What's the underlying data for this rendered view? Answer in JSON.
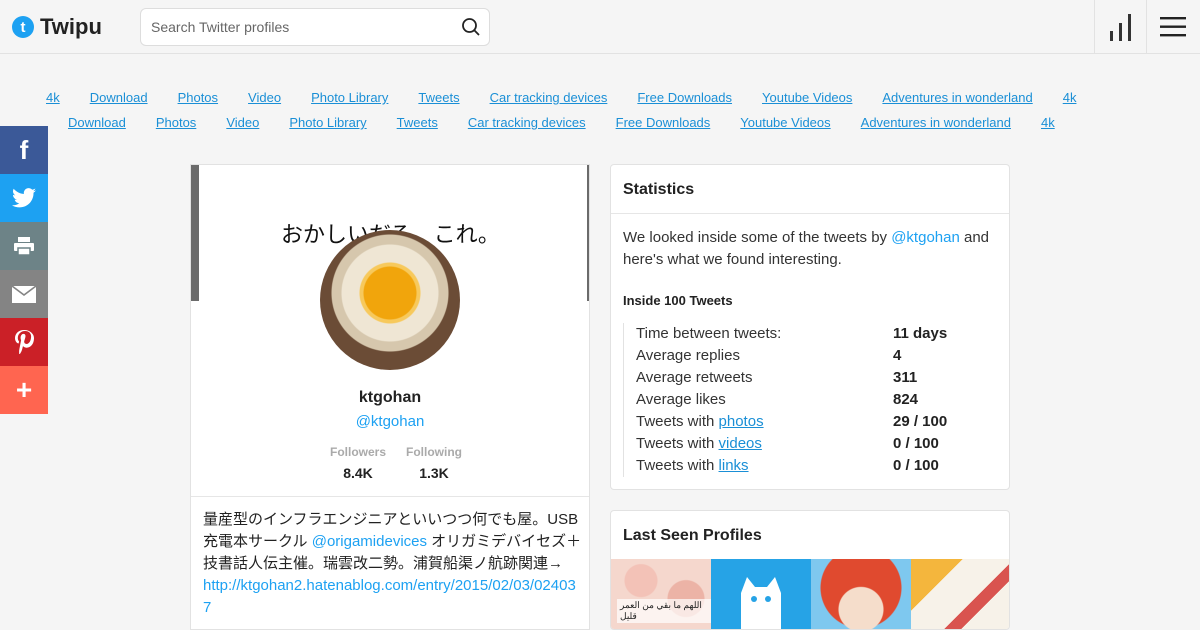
{
  "header": {
    "logo_glyph": "t",
    "logo_text": "Twipu",
    "search_placeholder": "Search Twitter profiles",
    "icons": {
      "search": "search-icon",
      "stats": "bar-chart-icon",
      "menu": "hamburger-menu-icon"
    }
  },
  "links_row1": [
    "4k",
    "Download",
    "Photos",
    "Video",
    "Photo Library",
    "Tweets",
    "Car tracking devices",
    "Free Downloads",
    "Youtube Videos",
    "Adventures in wonderland",
    "4k"
  ],
  "links_row2": [
    "Download",
    "Photos",
    "Video",
    "Photo Library",
    "Tweets",
    "Car tracking devices",
    "Free Downloads",
    "Youtube Videos",
    "Adventures in wonderland",
    "4k"
  ],
  "social": {
    "facebook": "f",
    "plus": "+",
    "icons": [
      "facebook-icon",
      "twitter-icon",
      "print-icon",
      "email-icon",
      "pinterest-icon",
      "plus-icon"
    ],
    "colors": {
      "facebook": "#3b5998",
      "twitter": "#1da1f2",
      "print": "#6d8387",
      "email": "#848484",
      "pinterest": "#cb2027",
      "plus": "#ff6550"
    }
  },
  "profile": {
    "banner_text": "おかしいだろ、これ。",
    "name": "ktgohan",
    "handle": "@ktgohan",
    "followers_label": "Followers",
    "followers": "8.4K",
    "following_label": "Following",
    "following": "1.3K",
    "bio_part1": "量産型のインフラエンジニアといいつつ何でも屋。USB充電本サークル ",
    "bio_mention": "@origamidevices",
    "bio_part2": " オリガミデバイセズ＋技書話人伝主催。瑞雲改二勢。浦賀船渠ノ航跡関連→",
    "bio_url": "http://ktgohan2.hatenablog.com/entry/2015/02/03/024037"
  },
  "statistics": {
    "title": "Statistics",
    "intro_before": "We looked inside some of the tweets by ",
    "intro_mention": "@ktgohan",
    "intro_after": " and here's what we found interesting.",
    "subtitle": "Inside 100 Tweets",
    "rows": [
      {
        "label": "Time between tweets:",
        "value": "11 days"
      },
      {
        "label": "Average replies",
        "value": "4"
      },
      {
        "label": "Average retweets",
        "value": "311"
      },
      {
        "label": "Average likes",
        "value": "824"
      },
      {
        "label_prefix": "Tweets with ",
        "label_link": "photos",
        "value": "29 / 100"
      },
      {
        "label_prefix": "Tweets with ",
        "label_link": "videos",
        "value": "0 / 100"
      },
      {
        "label_prefix": "Tweets with ",
        "label_link": "links",
        "value": "0 / 100"
      }
    ]
  },
  "last_seen": {
    "title": "Last Seen Profiles",
    "thumb1_caption": "اللهم ما بقي من العمر قليل"
  },
  "colors": {
    "accent": "#1da1f2",
    "link": "#1a8fd6",
    "background": "#f5f5f5"
  }
}
